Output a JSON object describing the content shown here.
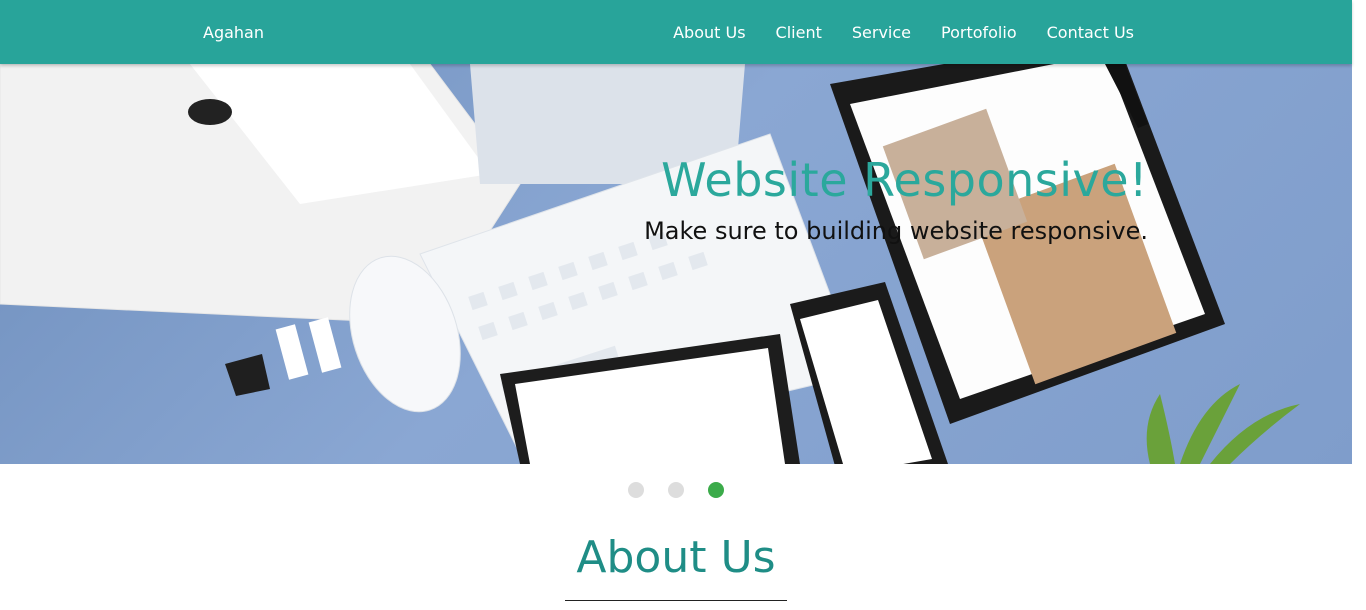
{
  "navbar": {
    "brand": "Agahan",
    "links": [
      "About Us",
      "Client",
      "Service",
      "Portofolio",
      "Contact Us"
    ]
  },
  "hero": {
    "title": "Website Responsive!",
    "subtitle": "Make sure to building website responsive.",
    "background_color": "#7f9dcb",
    "accent_color": "#2ba89c"
  },
  "carousel": {
    "slide_count": 3,
    "active_index": 2,
    "active_color": "#3bab4a"
  },
  "section": {
    "title": "About Us"
  },
  "colors": {
    "navbar": "#28a49a",
    "heading": "#1f8d86"
  }
}
